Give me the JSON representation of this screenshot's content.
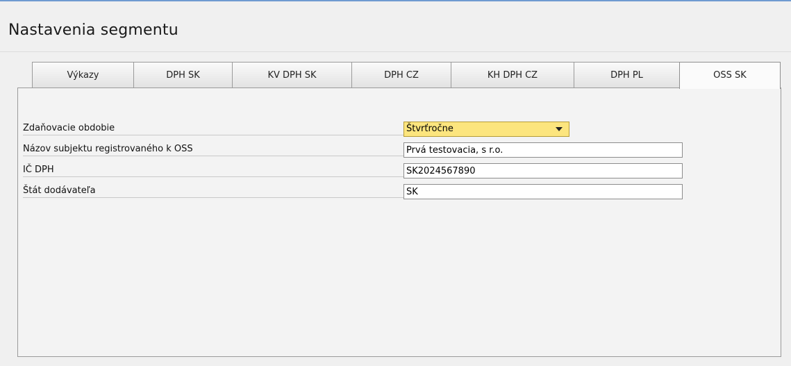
{
  "window": {
    "title": "Nastavenia segmentu"
  },
  "tabs": [
    {
      "label": "Výkazy",
      "active": false
    },
    {
      "label": "DPH SK",
      "active": false
    },
    {
      "label": "KV DPH SK",
      "active": false
    },
    {
      "label": "DPH CZ",
      "active": false
    },
    {
      "label": "KH DPH CZ",
      "active": false
    },
    {
      "label": "DPH PL",
      "active": false
    },
    {
      "label": "OSS SK",
      "active": true
    }
  ],
  "form": {
    "period": {
      "label": "Zdaňovacie obdobie",
      "value": "Štvrťročne"
    },
    "subject_name": {
      "label": "Názov subjektu registrovaného k OSS",
      "value": "Prvá testovacia, s r.o."
    },
    "vat_id": {
      "label": "IČ DPH",
      "value": "SK2024567890"
    },
    "supplier_state": {
      "label": "Štát dodávateľa",
      "value": "SK"
    }
  },
  "colors": {
    "dropdown_bg": "#fce57e",
    "window_accent": "#6f9ad1"
  }
}
